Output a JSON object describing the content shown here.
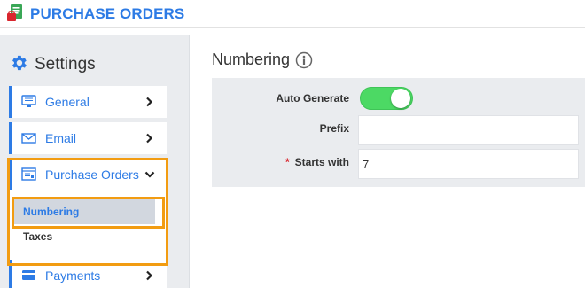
{
  "app": {
    "title": "PURCHASE ORDERS",
    "brand_color": "#2d7be5",
    "logo_icon": "purchase-orders-logo-icon"
  },
  "sidebar": {
    "heading": "Settings",
    "heading_icon": "gear-icon",
    "items": [
      {
        "label": "General",
        "icon": "monitor-icon",
        "expanded": false
      },
      {
        "label": "Email",
        "icon": "envelope-icon",
        "expanded": false
      },
      {
        "label": "Purchase Orders",
        "icon": "document-icon",
        "expanded": true
      },
      {
        "label": "Payments",
        "icon": "credit-card-icon",
        "expanded": false
      }
    ],
    "sub_items": [
      {
        "label": "Numbering",
        "active": true
      },
      {
        "label": "Taxes",
        "active": false
      }
    ],
    "highlight_color": "#f29c12"
  },
  "content": {
    "title": "Numbering",
    "title_icon": "info-icon",
    "form": {
      "auto_generate": {
        "label": "Auto Generate",
        "value": true,
        "on_color": "#4cd964"
      },
      "prefix": {
        "label": "Prefix",
        "value": ""
      },
      "starts_with": {
        "label": "Starts with",
        "required_mark": "*",
        "value": "7",
        "required_color": "#d9262e"
      }
    }
  }
}
